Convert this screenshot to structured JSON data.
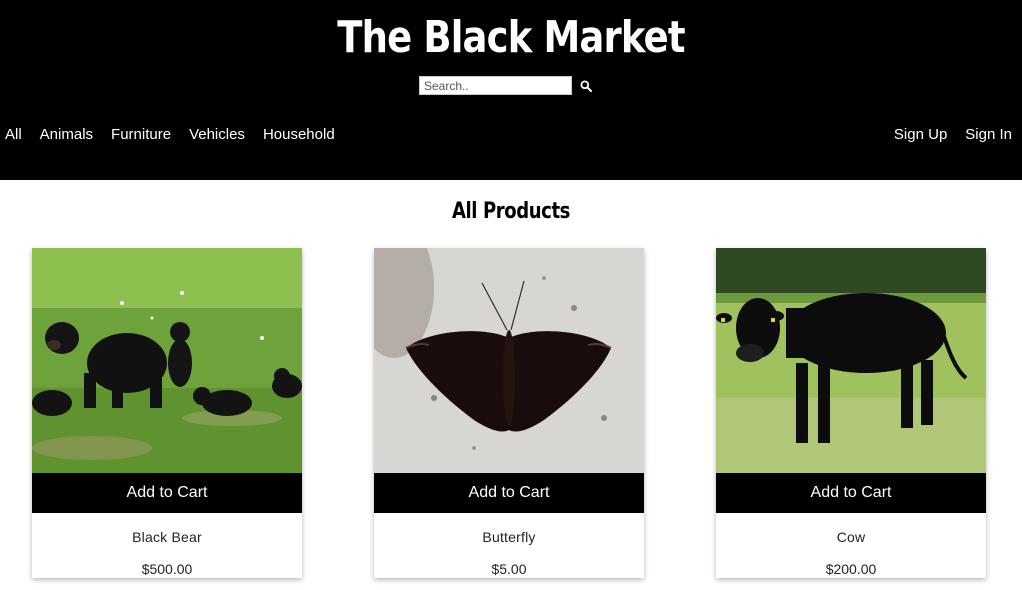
{
  "header": {
    "title": "The Black Market",
    "search": {
      "placeholder": "Search..",
      "value": "",
      "icon": "search-icon"
    }
  },
  "nav": {
    "left": [
      "All",
      "Animals",
      "Furniture",
      "Vehicles",
      "Household"
    ],
    "right": [
      "Sign Up",
      "Sign In"
    ]
  },
  "main": {
    "title": "All Products",
    "cart_label": "Add to Cart",
    "products": [
      {
        "name": "Black Bear",
        "price": "$500.00",
        "image": "black-bear-photo"
      },
      {
        "name": "Butterfly",
        "price": "$5.00",
        "image": "butterfly-photo"
      },
      {
        "name": "Cow",
        "price": "$200.00",
        "image": "cow-photo"
      }
    ]
  },
  "colors": {
    "header_bg": "#000000",
    "button_bg": "#000000",
    "page_bg": "#ffffff"
  }
}
